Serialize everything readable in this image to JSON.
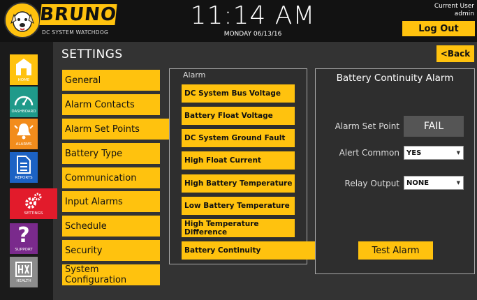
{
  "header": {
    "brand": "BRUNO",
    "brand_sub": "DC SYSTEM WATCHDOG",
    "time": "11:14 AM",
    "date": "MONDAY 06/13/16",
    "user_label": "Current User",
    "user_name": "admin",
    "logout_label": "Log Out"
  },
  "sidebar": {
    "items": [
      {
        "label": "HOME",
        "icon": "home-icon"
      },
      {
        "label": "DASHBOARD",
        "icon": "gauge-icon"
      },
      {
        "label": "ALARMS",
        "icon": "bell-icon"
      },
      {
        "label": "REPORTS",
        "icon": "document-icon"
      },
      {
        "label": "SETTINGS",
        "icon": "gears-icon"
      },
      {
        "label": "SUPPORT",
        "icon": "question-icon"
      },
      {
        "label": "HEALTH",
        "icon": "health-icon"
      }
    ]
  },
  "settings": {
    "title": "SETTINGS",
    "back_label": "<Back",
    "menu": [
      "General",
      "Alarm Contacts",
      "Alarm Set Points",
      "Battery Type",
      "Communication",
      "Input Alarms",
      "Schedule",
      "Security",
      "System Configuration"
    ],
    "active_menu_index": 2
  },
  "alarm": {
    "legend": "Alarm",
    "items": [
      "DC System Bus Voltage",
      "Battery Float Voltage",
      "DC System Ground Fault",
      "High Float Current",
      "High Battery Temperature",
      "Low Battery Temperature",
      "High Temperature Difference",
      "Battery Continuity"
    ],
    "active_index": 7
  },
  "detail": {
    "title": "Battery Continuity Alarm",
    "set_point_label": "Alarm Set Point",
    "set_point_value": "FAIL",
    "alert_common_label": "Alert Common",
    "alert_common_value": "YES",
    "relay_output_label": "Relay Output",
    "relay_output_value": "NONE",
    "test_label": "Test Alarm"
  },
  "colors": {
    "accent": "#ffc20e",
    "settings_active": "#e21b2b",
    "home": "#ffc20e",
    "dashboard": "#1f9a8a",
    "alarms": "#f28c1c",
    "reports": "#1c62c4",
    "support": "#7a2a8c",
    "health": "#8c8c8c"
  }
}
